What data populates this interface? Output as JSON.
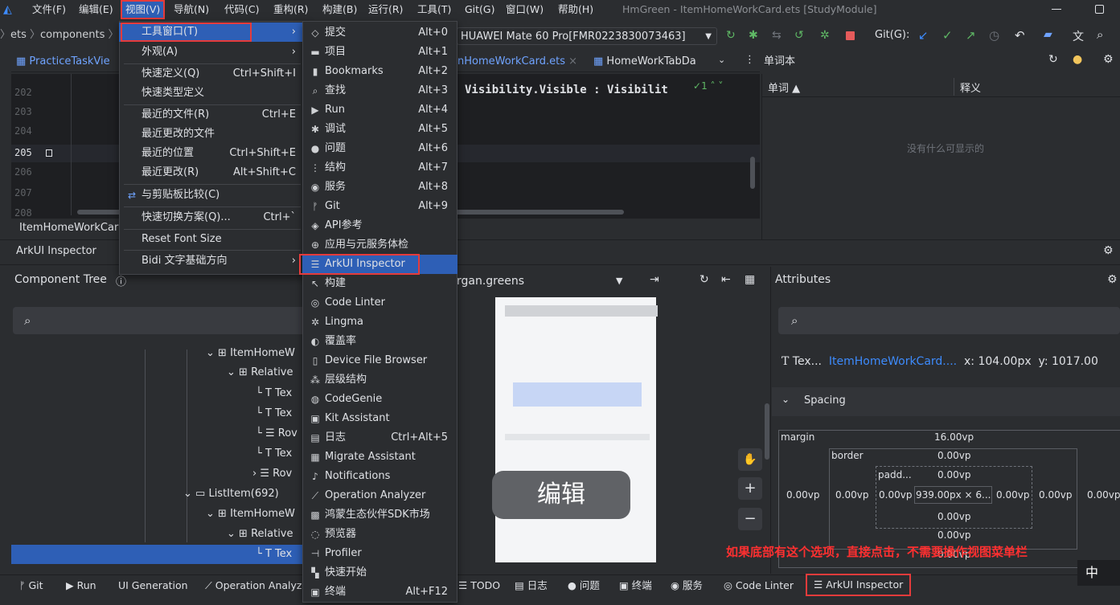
{
  "menubar": {
    "items": [
      "文件(F)",
      "编辑(E)",
      "视图(V)",
      "导航(N)",
      "代码(C)",
      "重构(R)",
      "构建(B)",
      "运行(R)",
      "工具(T)",
      "Git(G)",
      "窗口(W)",
      "帮助(H)"
    ],
    "title": "HmGreen - ItemHomeWorkCard.ets [StudyModule]"
  },
  "breadcrumb": {
    "part1": "ets",
    "part2": "components"
  },
  "toolbar": {
    "device": "HUAWEI Mate 60 Pro[FMR0223830073463]",
    "git_label": "Git(G):"
  },
  "tabs": {
    "tab1": "PracticeTaskVie",
    "tab2": "nHomeWorkCard.ets",
    "tab3": "HomeWorkTabDa",
    "right_title": "单词本"
  },
  "editor": {
    "lines": [
      "202",
      "203",
      "204",
      "205",
      "206",
      "207",
      "208"
    ],
    "code": "Visibility.Visible : Visibilit",
    "warn": "1"
  },
  "wordbook": {
    "col1": "单词 ▲",
    "col2": "释义",
    "empty": "没有什么可显示的"
  },
  "view_menu": {
    "items": [
      {
        "label": "工具窗口(T)",
        "shortcut": ""
      },
      {
        "label": "外观(A)",
        "shortcut": ""
      },
      {
        "label": "快速定义(Q)",
        "shortcut": "Ctrl+Shift+I"
      },
      {
        "label": "快速类型定义",
        "shortcut": ""
      },
      {
        "label": "最近的文件(R)",
        "shortcut": "Ctrl+E"
      },
      {
        "label": "最近更改的文件",
        "shortcut": ""
      },
      {
        "label": "最近的位置",
        "shortcut": "Ctrl+Shift+E"
      },
      {
        "label": "最近更改(R)",
        "shortcut": "Alt+Shift+C"
      },
      {
        "label": "与剪贴板比较(C)",
        "shortcut": ""
      },
      {
        "label": "快速切换方案(Q)...",
        "shortcut": "Ctrl+`"
      },
      {
        "label": "Reset Font Size",
        "shortcut": ""
      },
      {
        "label": "Bidi 文字基础方向",
        "shortcut": ""
      }
    ]
  },
  "tool_menu": {
    "items": [
      {
        "label": "提交",
        "shortcut": "Alt+0",
        "icon": "◇"
      },
      {
        "label": "项目",
        "shortcut": "Alt+1",
        "icon": "▬"
      },
      {
        "label": "Bookmarks",
        "shortcut": "Alt+2",
        "icon": "▮"
      },
      {
        "label": "查找",
        "shortcut": "Alt+3",
        "icon": "⌕"
      },
      {
        "label": "Run",
        "shortcut": "Alt+4",
        "icon": "▶"
      },
      {
        "label": "调试",
        "shortcut": "Alt+5",
        "icon": "✱"
      },
      {
        "label": "问题",
        "shortcut": "Alt+6",
        "icon": "●"
      },
      {
        "label": "结构",
        "shortcut": "Alt+7",
        "icon": "⋮"
      },
      {
        "label": "服务",
        "shortcut": "Alt+8",
        "icon": "◉"
      },
      {
        "label": "Git",
        "shortcut": "Alt+9",
        "icon": "ᚠ"
      },
      {
        "label": "API参考",
        "shortcut": "",
        "icon": "◈"
      },
      {
        "label": "应用与元服务体检",
        "shortcut": "",
        "icon": "⊕"
      },
      {
        "label": "ArkUI Inspector",
        "shortcut": "",
        "icon": "☰"
      },
      {
        "label": "构建",
        "shortcut": "",
        "icon": "↖"
      },
      {
        "label": "Code Linter",
        "shortcut": "",
        "icon": "◎"
      },
      {
        "label": "Lingma",
        "shortcut": "",
        "icon": "✲"
      },
      {
        "label": "覆盖率",
        "shortcut": "",
        "icon": "◐"
      },
      {
        "label": "Device File Browser",
        "shortcut": "",
        "icon": "▯"
      },
      {
        "label": "层级结构",
        "shortcut": "",
        "icon": "⁂"
      },
      {
        "label": "CodeGenie",
        "shortcut": "",
        "icon": "◍"
      },
      {
        "label": "Kit Assistant",
        "shortcut": "",
        "icon": "▣"
      },
      {
        "label": "日志",
        "shortcut": "Ctrl+Alt+5",
        "icon": "▤"
      },
      {
        "label": "Migrate Assistant",
        "shortcut": "",
        "icon": "▦"
      },
      {
        "label": "Notifications",
        "shortcut": "",
        "icon": "♪"
      },
      {
        "label": "Operation Analyzer",
        "shortcut": "",
        "icon": "⟋"
      },
      {
        "label": "鸿蒙生态伙伴SDK市场",
        "shortcut": "",
        "icon": "▩"
      },
      {
        "label": "预览器",
        "shortcut": "",
        "icon": "◌"
      },
      {
        "label": "Profiler",
        "shortcut": "",
        "icon": "⊣"
      },
      {
        "label": "快速开始",
        "shortcut": "",
        "icon": "▚"
      },
      {
        "label": "终端",
        "shortcut": "Alt+F12",
        "icon": "▣"
      }
    ]
  },
  "file_label": "ItemHomeWorkCar",
  "inspector": {
    "title": "ArkUI Inspector",
    "tree_title": "Component Tree",
    "process": "rgan.greens"
  },
  "tree": {
    "items": [
      "ItemHomeW",
      "Relative",
      "Tex",
      "Tex",
      "Rov",
      "Tex",
      "Rov",
      "ListItem(692)",
      "ItemHomeW",
      "Relative",
      "Tex"
    ]
  },
  "preview": {
    "edit_btn": "编辑"
  },
  "attributes": {
    "title": "Attributes",
    "t_label": "T",
    "node_short": "Tex...",
    "node_file": "ItemHomeWorkCard....",
    "x": "x: 104.00px",
    "y": "y: 1017.00",
    "spacing": "Spacing",
    "margin_label": "margin",
    "margin_top": "16.00vp",
    "border_label": "border",
    "border_top": "0.00vp",
    "padding_label": "padd...",
    "padding_top": "0.00vp",
    "size": "939.00px × 6...",
    "left1": "0.00vp",
    "left2": "0.00vp",
    "left3": "0.00vp",
    "right1": "0.00vp",
    "right2": "0.00vp",
    "right3": "0.00vp",
    "bottom1": "0.00vp",
    "bottom2": "0.00vp",
    "bottom3": "0.00vp"
  },
  "annotation": "如果底部有这个选项，直接点击，不需要操作视图菜单栏",
  "bottombar": {
    "items": [
      "Git",
      "Run",
      "UI Generation",
      "Operation Analyz",
      "TODO",
      "日志",
      "问题",
      "终端",
      "服务",
      "Code Linter",
      "ArkUI Inspector"
    ]
  },
  "ime": "中",
  "colors": {
    "accent": "#2e5fb6",
    "red": "#e53b3b",
    "annotation": "#ff3030"
  }
}
